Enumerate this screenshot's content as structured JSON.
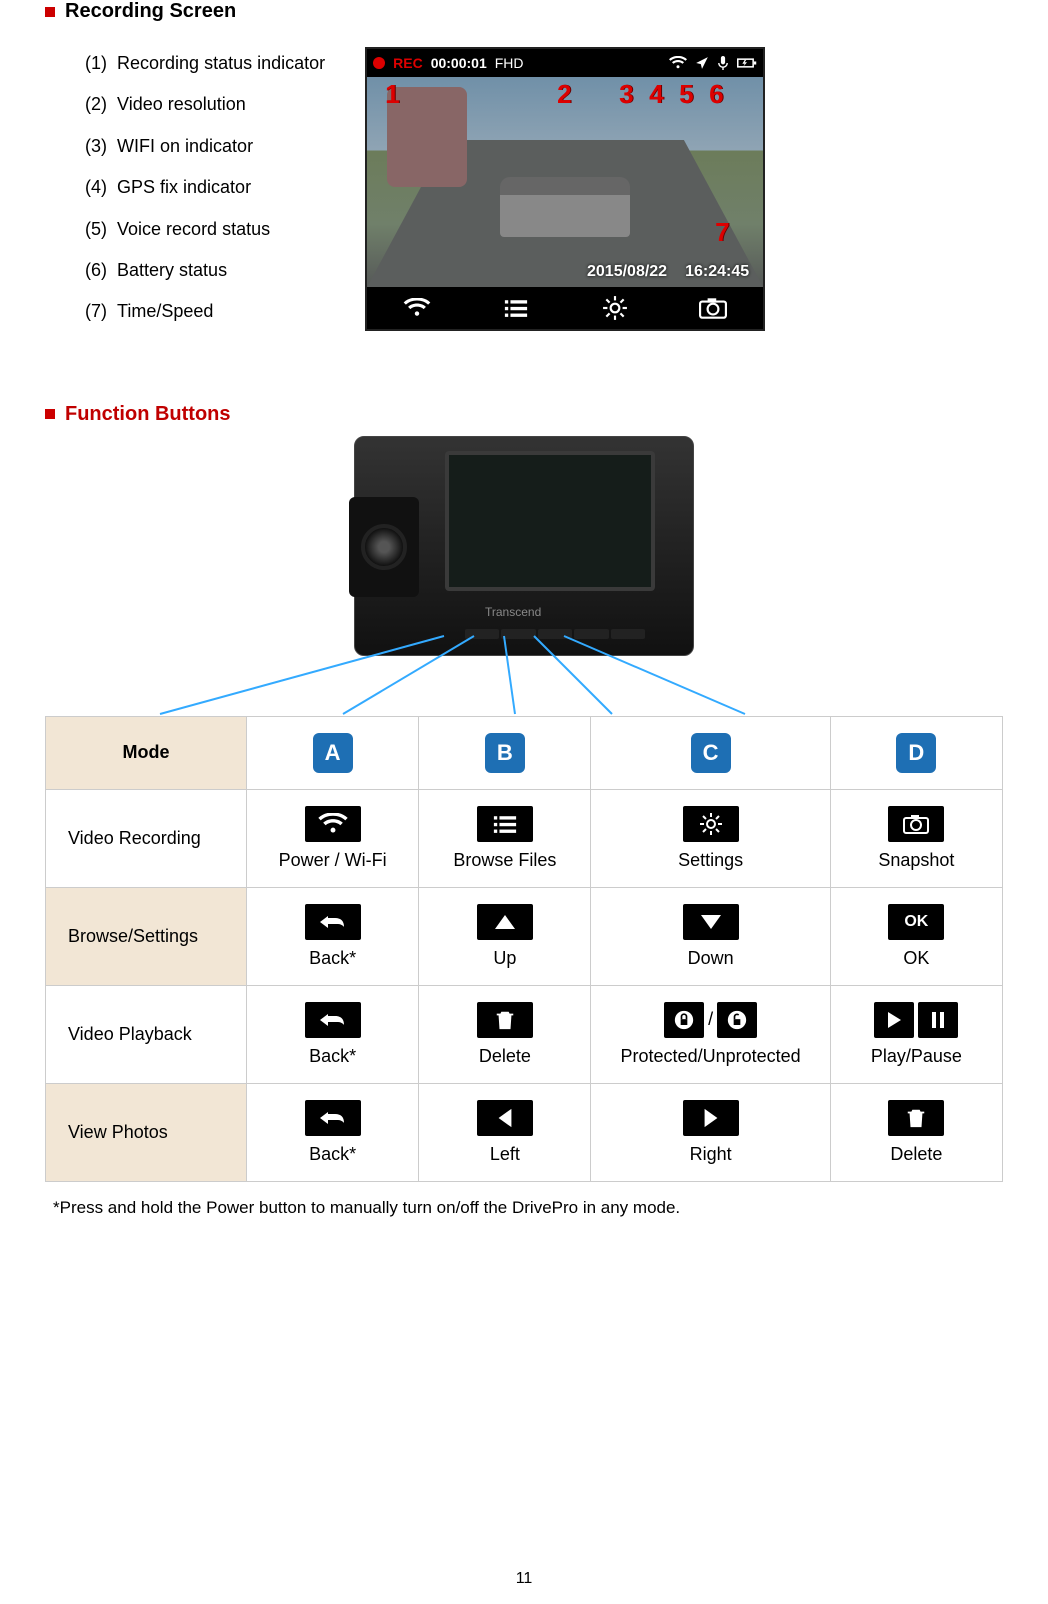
{
  "sections": {
    "recording_heading": "Recording Screen",
    "functions_heading": "Function Buttons"
  },
  "recording_list": [
    {
      "num": "(1)",
      "label": "Recording status indicator"
    },
    {
      "num": "(2)",
      "label": "Video resolution"
    },
    {
      "num": "(3)",
      "label": "WIFI on indicator"
    },
    {
      "num": "(4)",
      "label": "GPS fix indicator"
    },
    {
      "num": "(5)",
      "label": "Voice record status"
    },
    {
      "num": "(6)",
      "label": "Battery status"
    },
    {
      "num": "(7)",
      "label": "Time/Speed"
    }
  ],
  "screen": {
    "rec_label": "REC",
    "timer": "00:00:01",
    "video_res": "FHD",
    "date": "2015/08/22",
    "time": "16:24:45",
    "numbers": [
      "1",
      "2",
      "3",
      "4",
      "5",
      "6",
      "7"
    ]
  },
  "device": {
    "brand": "Transcend"
  },
  "table": {
    "mode_header": "Mode",
    "columns": [
      "A",
      "B",
      "C",
      "D"
    ],
    "rows": [
      {
        "label": "Video Recording",
        "cells": [
          {
            "text": "Power / Wi-Fi",
            "icon": "wifi-icon"
          },
          {
            "text": "Browse Files",
            "icon": "list-icon"
          },
          {
            "text": "Settings",
            "icon": "settings-icon"
          },
          {
            "text": "Snapshot",
            "icon": "camera-icon"
          }
        ],
        "alt": false
      },
      {
        "label": "Browse/Settings",
        "cells": [
          {
            "text": "Back*",
            "icon": "back-icon"
          },
          {
            "text": "Up",
            "icon": "up-icon"
          },
          {
            "text": "Down",
            "icon": "down-icon"
          },
          {
            "text": "OK",
            "icon": "ok-icon"
          }
        ],
        "alt": true
      },
      {
        "label": "Video Playback",
        "cells": [
          {
            "text": "Back*",
            "icon": "back-icon"
          },
          {
            "text": "Delete",
            "icon": "trash-icon"
          },
          {
            "text": "Protected/Unprotected",
            "icon": "lock-pair-icon",
            "sep": "/"
          },
          {
            "text": "Play/Pause",
            "icon": "play-pause-icon"
          }
        ],
        "alt": false
      },
      {
        "label": "View Photos",
        "cells": [
          {
            "text": "Back*",
            "icon": "back-icon"
          },
          {
            "text": "Left",
            "icon": "left-icon"
          },
          {
            "text": "Right",
            "icon": "right-icon"
          },
          {
            "text": "Delete",
            "icon": "trash-icon"
          }
        ],
        "alt": true
      }
    ]
  },
  "footnote": "*Press and hold the Power button to manually turn on/off the DrivePro in any mode.",
  "page_number": "11"
}
